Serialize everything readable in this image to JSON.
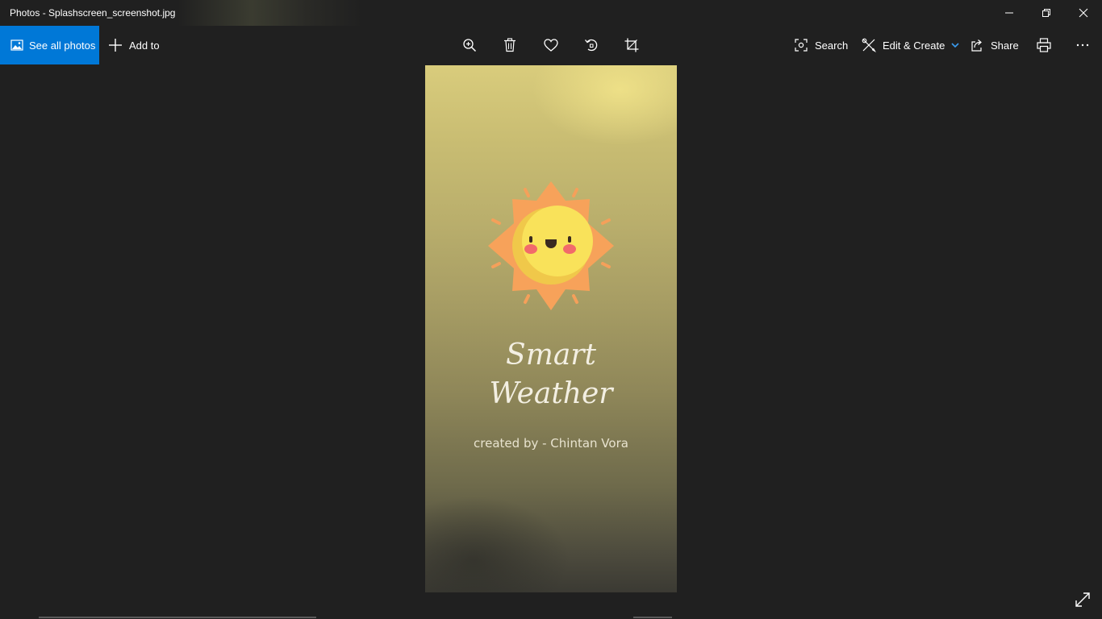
{
  "window": {
    "title": "Photos - Splashscreen_screenshot.jpg"
  },
  "toolbar": {
    "see_all_photos": "See all photos",
    "add_to": "Add to",
    "search": "Search",
    "edit_create": "Edit & Create",
    "share": "Share",
    "accent_color": "#0078d7"
  },
  "photo": {
    "app_title_line1": "Smart",
    "app_title_line2": "Weather",
    "credit": "created by - Chintan Vora"
  }
}
